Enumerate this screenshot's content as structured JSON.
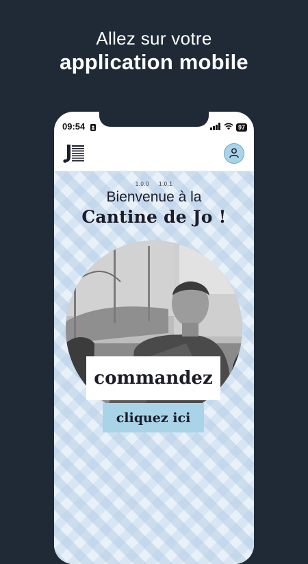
{
  "promo": {
    "line1": "Allez sur votre",
    "line2": "application mobile"
  },
  "status_bar": {
    "time": "09:54",
    "battery": "97"
  },
  "header": {
    "logo_icon": "cantine-logo-icon",
    "profile_icon": "user-icon"
  },
  "main": {
    "versions": [
      "1.0.0",
      "1.0.1"
    ],
    "welcome": "Bienvenue à la",
    "brand": "Cantine de Jo !",
    "order_label": "commandez",
    "cta_label": "cliquez ici"
  },
  "colors": {
    "page_background": "#1f2a36",
    "accent": "#a9d4e8",
    "text_dark": "#1c1c2a"
  }
}
